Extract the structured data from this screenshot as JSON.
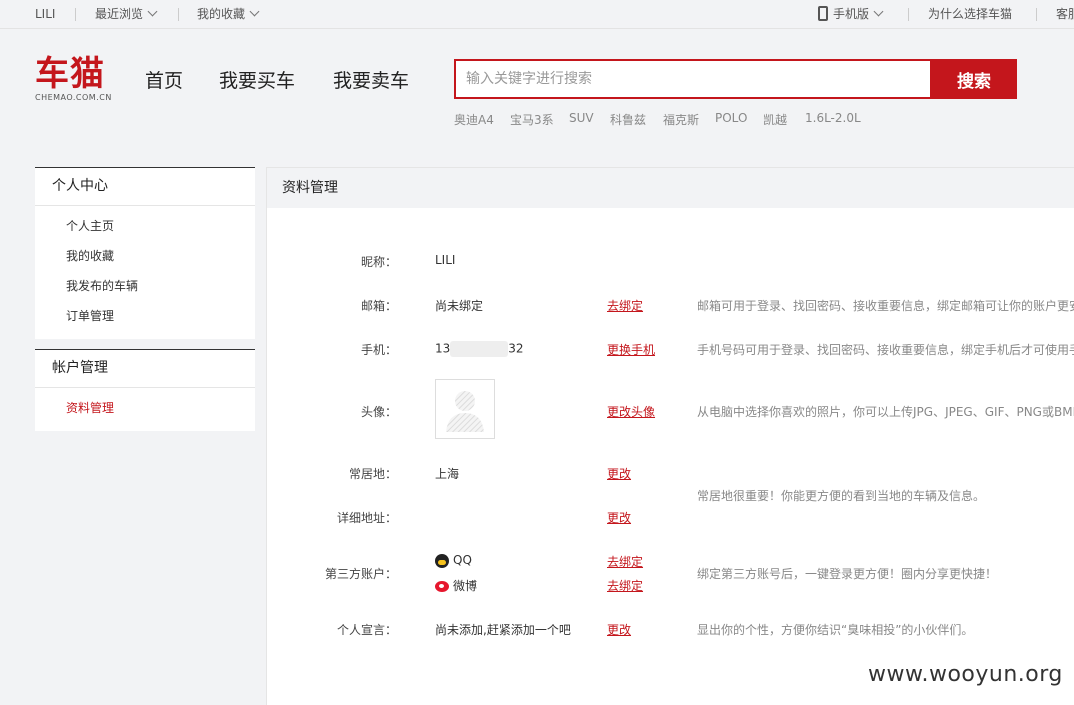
{
  "topbar": {
    "user": "LILI",
    "recent": "最近浏览",
    "favorites": "我的收藏",
    "mobile": "手机版",
    "why": "为什么选择车猫",
    "service": "客服"
  },
  "logo": {
    "name": "车猫",
    "domain": "CHEMAO.COM.CN"
  },
  "nav": {
    "home": "首页",
    "buy": "我要买车",
    "sell": "我要卖车"
  },
  "search": {
    "placeholder": "输入关键字进行搜索",
    "button": "搜索"
  },
  "hot_keywords": [
    "奥迪A4",
    "宝马3系",
    "SUV",
    "科鲁兹",
    "福克斯",
    "POLO",
    "凯越",
    "1.6L-2.0L"
  ],
  "sidebar": {
    "personal": {
      "title": "个人中心",
      "items": [
        "个人主页",
        "我的收藏",
        "我发布的车辆",
        "订单管理"
      ]
    },
    "account": {
      "title": "帐户管理",
      "items": [
        "资料管理"
      ]
    }
  },
  "main": {
    "title": "资料管理",
    "nickname": {
      "label": "昵称：",
      "value": "LILI"
    },
    "email": {
      "label": "邮箱：",
      "value": "尚未绑定",
      "action": "去绑定",
      "desc": "邮箱可用于登录、找回密码、接收重要信息，绑定邮箱可让你的账户更安全"
    },
    "phone": {
      "label": "手机：",
      "prefix": "13",
      "suffix": "32",
      "action": "更换手机",
      "desc": "手机号码可用于登录、找回密码、接收重要信息，绑定手机后才可使用手机登录"
    },
    "avatar": {
      "label": "头像：",
      "action": "更改头像",
      "desc": "从电脑中选择你喜欢的照片，你可以上传JPG、JPEG、GIF、PNG或BMP文件"
    },
    "residence": {
      "label": "常居地：",
      "value": "上海",
      "action": "更改"
    },
    "address": {
      "label": "详细地址：",
      "action": "更改"
    },
    "location_desc": "常居地很重要！你能更方便的看到当地的车辆及信息。",
    "third_party": {
      "label": "第三方账户：",
      "qq": "QQ",
      "weibo": "微博",
      "qq_action": "去绑定",
      "weibo_action": "去绑定",
      "desc": "绑定第三方账号后，一键登录更方便！圈内分享更快捷！"
    },
    "motto": {
      "label": "个人宣言：",
      "value": "尚未添加,赶紧添加一个吧",
      "action": "更改",
      "desc": "显出你的个性，方便你结识“臭味相投”的小伙伴们。"
    }
  },
  "watermark": "www.wooyun.org"
}
